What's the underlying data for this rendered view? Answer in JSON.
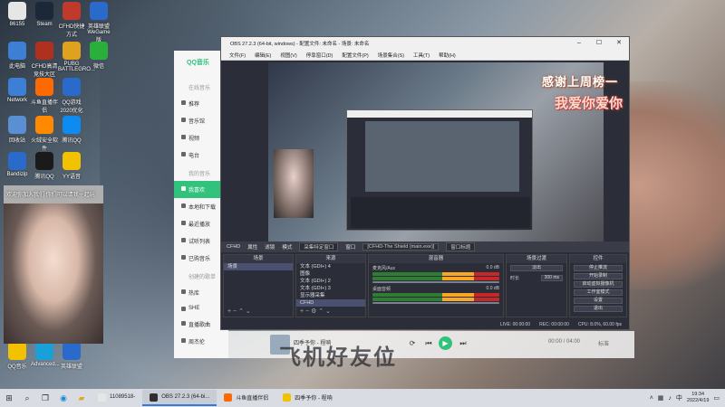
{
  "desktop": {
    "icons": [
      {
        "label": "86155",
        "color": "#e6e6e6"
      },
      {
        "label": "Steam",
        "color": "#1b2838"
      },
      {
        "label": "CFHD快捷方式",
        "color": "#c03a2b"
      },
      {
        "label": "英雄联盟WeGame版",
        "color": "#2a6acb"
      },
      {
        "label": "此电脑",
        "color": "#3d7fd4"
      },
      {
        "label": "CFHD高清竞技大区",
        "color": "#b03020"
      },
      {
        "label": "PUBG BATTLEGRO...",
        "color": "#e0a020"
      },
      {
        "label": "微信",
        "color": "#2aae3c"
      },
      {
        "label": "Network",
        "color": "#3d7fd4"
      },
      {
        "label": "斗鱼直播伴侣",
        "color": "#ff6a00"
      },
      {
        "label": "QQ游戏 2020优化",
        "color": "#2a6acb"
      },
      {
        "label": "回收站",
        "color": "#5a8fd4"
      },
      {
        "label": "火绒安全软件",
        "color": "#ff8a00"
      },
      {
        "label": "腾讯QQ",
        "color": "#0e8bf1"
      },
      {
        "label": "Bandizip",
        "color": "#2a6acb"
      },
      {
        "label": "腾讯QQ",
        "color": "#1a1a1a"
      },
      {
        "label": "YY语音",
        "color": "#f2c200"
      },
      {
        "label": "QQ音乐",
        "color": "#f2c200"
      },
      {
        "label": "Advanced...",
        "color": "#1aa0d8"
      },
      {
        "label": "英雄联盟",
        "color": "#2a6acb"
      }
    ]
  },
  "webcam_overlay": {
    "caption": "欢迎你加入我们 你们可以请我一起玩"
  },
  "qq_music": {
    "logo": "QQ音乐",
    "section_online": "在线音乐",
    "nav": [
      {
        "label": "推荐",
        "active": false
      },
      {
        "label": "音乐馆",
        "active": false
      },
      {
        "label": "视频",
        "active": false
      },
      {
        "label": "电台",
        "active": false
      }
    ],
    "section_mine": "我的音乐",
    "nav_mine": [
      {
        "label": "我喜欢",
        "active": true
      },
      {
        "label": "本地和下载",
        "active": false
      },
      {
        "label": "最近播放",
        "active": false
      },
      {
        "label": "试听列表",
        "active": false
      },
      {
        "label": "已购音乐",
        "active": false
      }
    ],
    "section_created": "创建的歌单",
    "playlists": [
      "热库",
      "SHE",
      "直播歌曲",
      "周杰伦"
    ]
  },
  "player": {
    "song": "四季予你 - 程响",
    "time": "00:00 / 04:00",
    "quality": "标准",
    "prev_icon": "⏮",
    "play_icon": "▶",
    "next_icon": "⏭",
    "loop_icon": "⟳"
  },
  "obs": {
    "title": "OBS 27.2.3 (64-bit, windows) - 配置文件: 未命名 - 场景: 未命名",
    "menu": [
      "文件(F)",
      "编辑(E)",
      "视图(V)",
      "停靠窗口(D)",
      "配置文件(P)",
      "场景集合(S)",
      "工具(T)",
      "帮助(H)"
    ],
    "scenebar": {
      "label": "CFHD",
      "props": "属性",
      "filters": "滤镜",
      "mode": "模式",
      "mode_value": "采集特定窗口",
      "window": "窗口",
      "window_value": "[CFHD-The Shield (main.exe)]",
      "priority": "窗口标题"
    },
    "scenes": {
      "title": "场景",
      "items": [
        "场景"
      ]
    },
    "sources": {
      "title": "来源",
      "items": [
        {
          "label": "文本 (GDI+) 4",
          "selected": false
        },
        {
          "label": "图像",
          "selected": false
        },
        {
          "label": "文本 (GDI+) 2",
          "selected": false
        },
        {
          "label": "文本 (GDI+) 3",
          "selected": false
        },
        {
          "label": "显示器采集",
          "selected": false
        },
        {
          "label": "CFHD",
          "selected": true
        }
      ]
    },
    "mixer": {
      "title": "混音器",
      "channels": [
        {
          "name": "麦克风/Aux",
          "db": "0.0 dB"
        },
        {
          "name": "桌面音频",
          "db": "0.0 dB"
        }
      ]
    },
    "transitions": {
      "title": "场景过渡",
      "type": "淡出",
      "duration_label": "时长",
      "duration": "300 ms"
    },
    "controls": {
      "title": "控件",
      "buttons": [
        "停止推流",
        "开始录制",
        "启动虚拟摄像机",
        "工作室模式",
        "设置",
        "退出"
      ]
    },
    "status": {
      "live": "LIVE: 00:00:00",
      "rec": "REC: 00:00:00",
      "cpu": "CPU: 8.0%, 60.00 fps"
    }
  },
  "overlay": {
    "banner_top": "感谢上周榜一",
    "banner_bottom": "我爱你爱你",
    "bottom_text": "飞机好友位"
  },
  "taskbar": {
    "apps": [
      {
        "label": "11089518-",
        "color": "#e6e6e6",
        "active": false
      },
      {
        "label": "OBS 27.2.3 (64-bi...",
        "color": "#302e31",
        "active": true
      },
      {
        "label": "斗鱼直播伴侣",
        "color": "#ff6a00",
        "active": false
      },
      {
        "label": "四季予你 - 程响",
        "color": "#f2c200",
        "active": false
      }
    ],
    "time": "19:34",
    "date": "2022/4/19",
    "lang": "中"
  }
}
